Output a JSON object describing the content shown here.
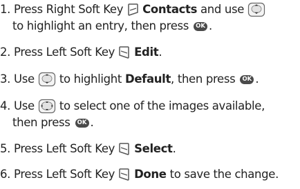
{
  "steps": [
    {
      "number": "1.",
      "t1": "Press Right Soft Key",
      "t2": "Contacts",
      "t3": "and use",
      "t4": "to highlight an entry, then press",
      "t5": "."
    },
    {
      "number": "2.",
      "t1": "Press Left Soft Key",
      "t2": "Edit",
      "t3": "."
    },
    {
      "number": "3.",
      "t1": "Use",
      "t2": "to highlight",
      "t3": "Default",
      "t4": ", then press",
      "t5": "."
    },
    {
      "number": "4.",
      "t1": "Use",
      "t2": "to select one of the images available,",
      "t3": "then press",
      "t4": "."
    },
    {
      "number": "5.",
      "t1": "Press Left Soft Key",
      "t2": "Select",
      "t3": "."
    },
    {
      "number": "6.",
      "t1": "Press Left Soft Key",
      "t2": "Done",
      "t3": "to save the change."
    }
  ],
  "ok_key_label": "OK",
  "icons": {
    "right_soft_key": "right-soft-key-icon",
    "left_soft_key": "left-soft-key-icon",
    "nav_key_updown": "navigation-key-updown-icon",
    "nav_key_4way": "navigation-key-4way-icon",
    "ok_key": "ok-key-icon"
  }
}
